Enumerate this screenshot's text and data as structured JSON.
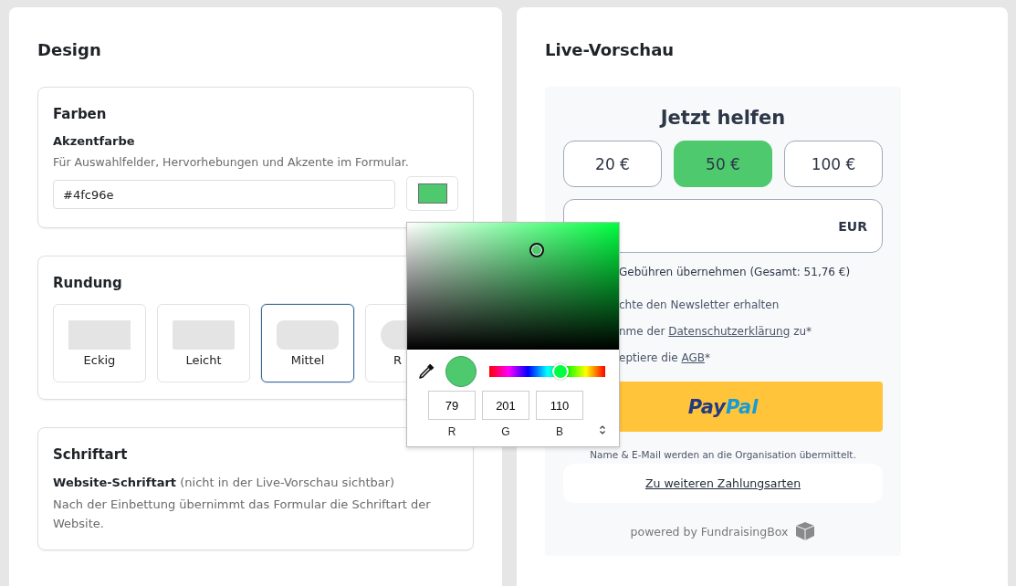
{
  "design": {
    "title": "Design",
    "colors": {
      "title": "Farben",
      "label": "Akzentfarbe",
      "hint": "Für Auswahlfelder, Hervorhebungen und Akzente im Formular.",
      "value": "#4fc96e"
    },
    "rounding": {
      "title": "Rundung",
      "options": [
        {
          "label": "Eckig",
          "kind": "square",
          "selected": false
        },
        {
          "label": "Leicht",
          "kind": "slight",
          "selected": false
        },
        {
          "label": "Mittel",
          "kind": "medium",
          "selected": true
        },
        {
          "label": "R",
          "kind": "round",
          "selected": false
        }
      ]
    },
    "font": {
      "title": "Schriftart",
      "label": "Website-Schriftart",
      "label_note": "(nicht in der Live-Vorschau sichtbar)",
      "hint": "Nach der Einbettung übernimmt das Formular die Schriftart der Website."
    }
  },
  "color_picker": {
    "hue": {
      "level": 0.617
    },
    "channels": [
      {
        "label": "R",
        "value": "79"
      },
      {
        "label": "G",
        "value": "201"
      },
      {
        "label": "B",
        "value": "110"
      }
    ]
  },
  "preview": {
    "title": "Live-Vorschau",
    "heading": "Jetzt helfen",
    "amounts": [
      {
        "label": "20 €",
        "selected": false
      },
      {
        "label": "50 €",
        "selected": true
      },
      {
        "label": "100 €",
        "selected": false
      }
    ],
    "currency": "EUR",
    "options": [
      {
        "text": "Gebühren übernehmen (Gesamt: 51,76 €)"
      },
      {
        "text": "chte den Newsletter erhalten"
      },
      {
        "text": "nme der",
        "link": "Datenschutzerklärung",
        "after": "zu*"
      },
      {
        "text": "eptiere die",
        "link": "AGB",
        "after": "*"
      }
    ],
    "paypal": {
      "first": "Pay",
      "second": "Pal"
    },
    "note": "Name & E-Mail werden an die Organisation übermittelt.",
    "more_link": "Zu weiteren Zahlungsarten",
    "powered": "powered by FundraisingBox"
  }
}
